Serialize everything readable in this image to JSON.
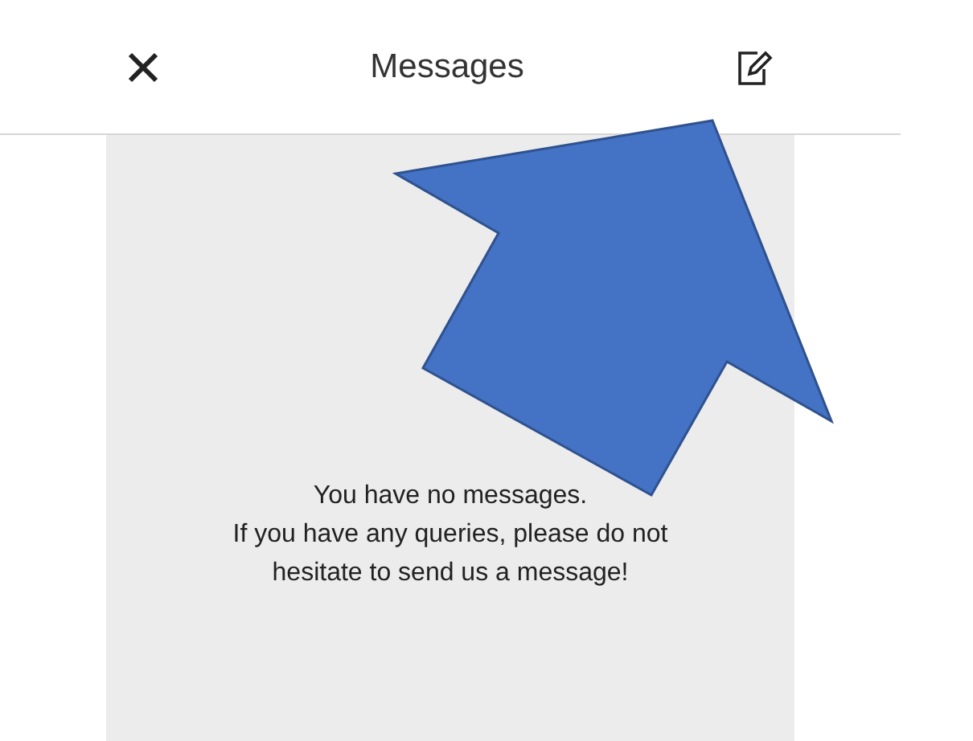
{
  "header": {
    "title": "Messages"
  },
  "empty_state": {
    "lines": [
      "You have no messages.",
      "If you have any queries, please do not",
      "hesitate to send us a message!"
    ]
  }
}
